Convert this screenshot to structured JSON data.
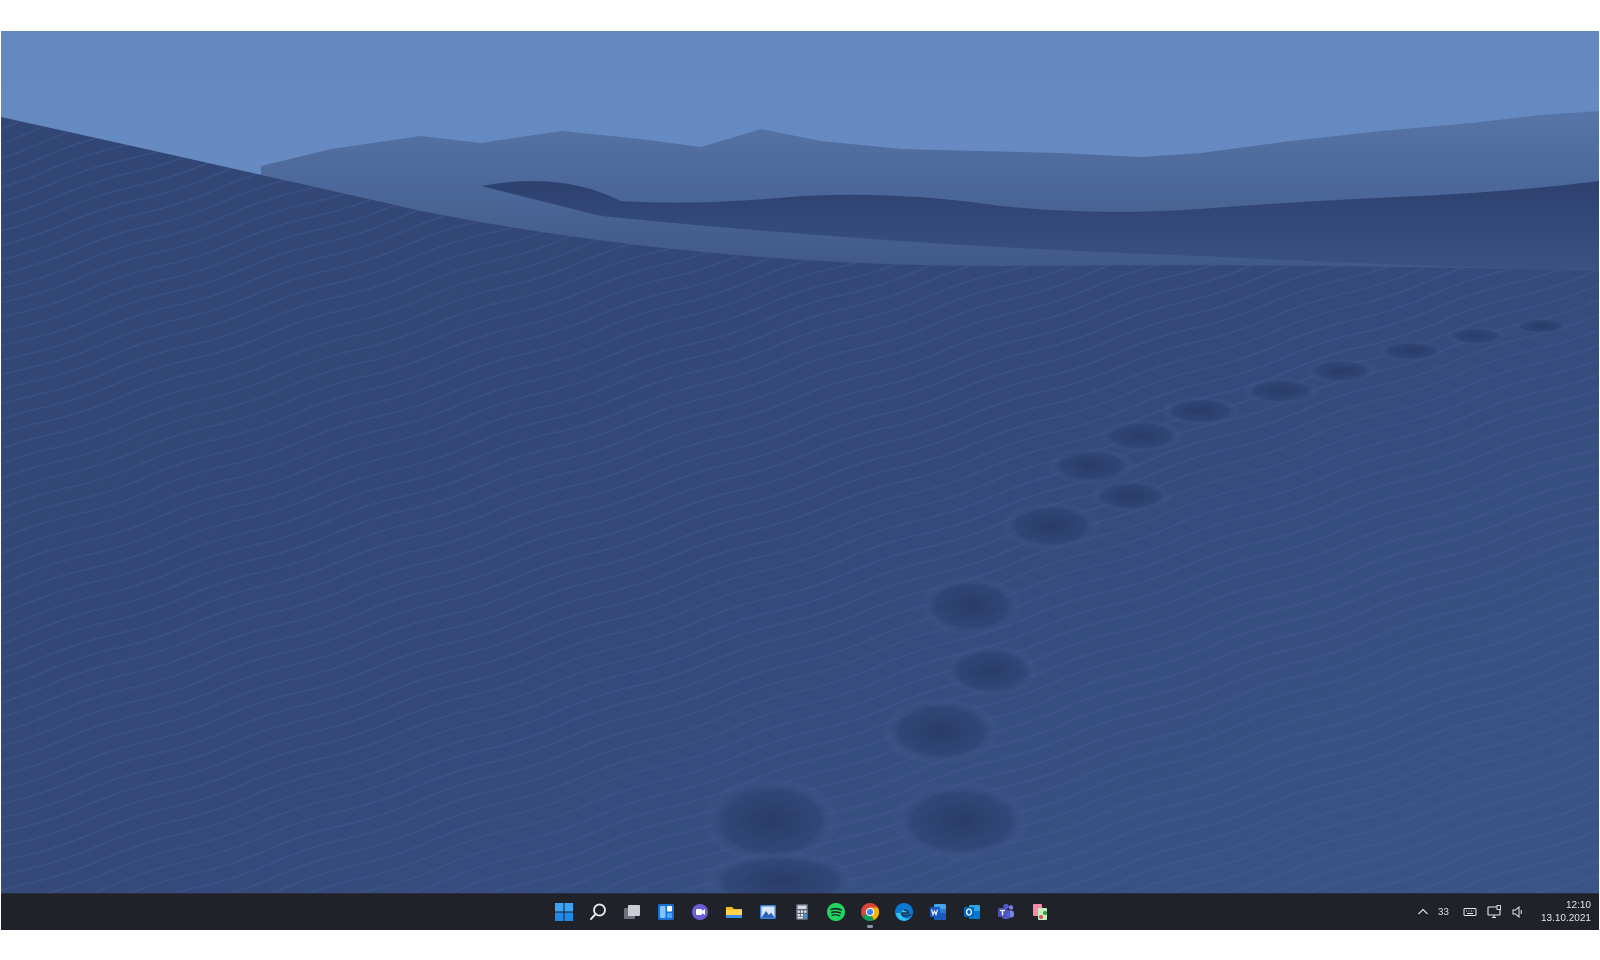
{
  "desktop": {
    "wallpaper_icon": "sand-dunes-wallpaper"
  },
  "taskbar": {
    "apps": [
      {
        "name": "start-button",
        "icon": "windows-logo-icon",
        "running": false
      },
      {
        "name": "search-button",
        "icon": "search-icon",
        "running": false
      },
      {
        "name": "task-view-button",
        "icon": "task-view-icon",
        "running": false
      },
      {
        "name": "widgets-button",
        "icon": "widgets-icon",
        "running": false
      },
      {
        "name": "chat-button",
        "icon": "chat-icon",
        "running": false
      },
      {
        "name": "file-explorer-button",
        "icon": "folder-icon",
        "running": false
      },
      {
        "name": "photos-button",
        "icon": "photos-icon",
        "running": false
      },
      {
        "name": "calculator-button",
        "icon": "calculator-icon",
        "running": false
      },
      {
        "name": "spotify-button",
        "icon": "spotify-icon",
        "running": false
      },
      {
        "name": "chrome-button",
        "icon": "chrome-icon",
        "running": true
      },
      {
        "name": "edge-button",
        "icon": "edge-icon",
        "running": false
      },
      {
        "name": "word-button",
        "icon": "word-icon",
        "running": false
      },
      {
        "name": "outlook-button",
        "icon": "outlook-icon",
        "running": false
      },
      {
        "name": "teams-button",
        "icon": "teams-icon",
        "running": false
      },
      {
        "name": "snipping-tool-button",
        "icon": "snipping-tool-icon",
        "running": false
      }
    ]
  },
  "tray": {
    "overflow_icon": "chevron-up-icon",
    "temperature": "33",
    "keyboard_icon": "keyboard-icon",
    "network_icon": "network-icon",
    "volume_icon": "volume-icon",
    "time": "12:10",
    "date": "13.10.2021"
  },
  "colors": {
    "sky": "#6b91c6",
    "dunes": "#33497a",
    "taskbar": "#1f2228",
    "accent": "#1ea0f2"
  }
}
